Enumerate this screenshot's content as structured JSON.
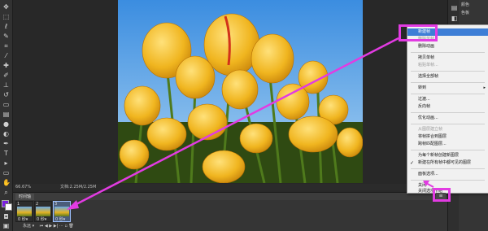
{
  "status": {
    "zoom": "66.67%",
    "doc": "文档:2.25M/2.25M"
  },
  "timeline": {
    "tab": "时间轴",
    "frames": [
      {
        "num": "1",
        "duration": "0 秒▾"
      },
      {
        "num": "2",
        "duration": "0 秒▾"
      },
      {
        "num": "3",
        "duration": "0 秒▾"
      }
    ],
    "loop": "永远 ▾"
  },
  "right_panel": {
    "items": [
      "颜色",
      "色板",
      "调整",
      "样式",
      "图层",
      "通道",
      "路径"
    ]
  },
  "context_menu": {
    "items": [
      {
        "label": "新建帧",
        "state": "highlight"
      },
      {
        "label": "删除单帧",
        "state": "disabled"
      },
      {
        "label": "删除动画",
        "state": "normal"
      },
      {
        "label": "拷贝单帧",
        "state": "normal"
      },
      {
        "label": "粘贴单帧...",
        "state": "disabled"
      },
      {
        "label": "选择全部帧",
        "state": "normal"
      },
      {
        "label": "转到",
        "state": "submenu"
      },
      {
        "label": "过渡...",
        "state": "normal"
      },
      {
        "label": "反向帧",
        "state": "normal"
      },
      {
        "label": "优化动画...",
        "state": "normal"
      },
      {
        "label": "从图层建立帧",
        "state": "disabled"
      },
      {
        "label": "将帧拼合到图层",
        "state": "normal"
      },
      {
        "label": "跨帧匹配图层...",
        "state": "normal"
      },
      {
        "label": "为每个新帧创建新图层",
        "state": "normal"
      },
      {
        "label": "新建在所有帧中都可见的图层",
        "state": "checked"
      },
      {
        "label": "面板选项...",
        "state": "normal"
      },
      {
        "label": "关闭",
        "state": "normal"
      },
      {
        "label": "关闭选项卡组",
        "state": "normal"
      }
    ]
  }
}
